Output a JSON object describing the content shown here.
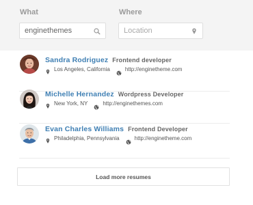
{
  "search": {
    "what_label": "What",
    "what_value": "enginethemes",
    "where_label": "Where",
    "where_placeholder": "Location",
    "what_icon": "search-icon",
    "where_icon": "map-pin-icon"
  },
  "resumes": [
    {
      "name": "Sandra Rodriguez",
      "role": "Frontend developer",
      "location": "Los Angeles, California",
      "website": "http://enginetheme.com"
    },
    {
      "name": "Michelle Hernandez",
      "role": "Wordpress Developer",
      "location": "New York, NY",
      "website": "http://enginethemes.com"
    },
    {
      "name": "Evan Charles Williams",
      "role": "Frontend Developer",
      "location": "Philadelphia, Pennsylvania",
      "website": "http://enginetheme.com"
    }
  ],
  "load_more_label": "Load more resumes",
  "colors": {
    "name_link": "#3f7fb3",
    "panel_bg": "#f4f4f4"
  }
}
